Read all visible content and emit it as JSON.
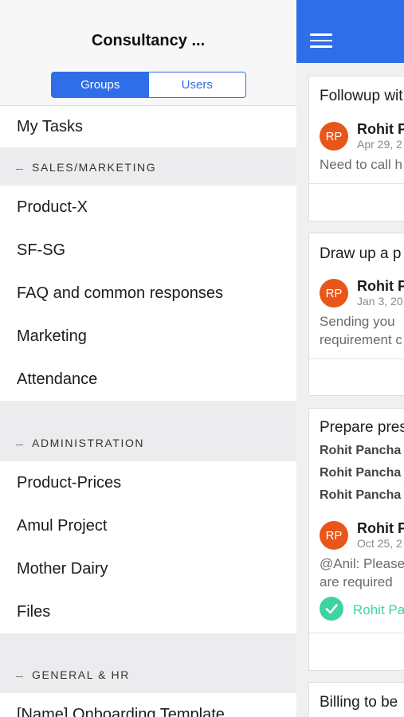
{
  "drawer": {
    "title": "Consultancy ...",
    "tabs": [
      {
        "label": "Groups",
        "active": true
      },
      {
        "label": "Users",
        "active": false
      }
    ],
    "my_tasks": "My Tasks",
    "sections": [
      {
        "title": "SALES/MARKETING",
        "items": [
          "Product-X",
          "SF-SG",
          "FAQ and common responses",
          "Marketing",
          "Attendance"
        ]
      },
      {
        "title": "ADMINISTRATION",
        "items": [
          "Product-Prices",
          "Amul Project",
          "Mother Dairy",
          "Files"
        ]
      },
      {
        "title": "GENERAL & HR",
        "items": [
          "[Name] Onboarding Template"
        ]
      }
    ]
  },
  "topbar": {
    "menu_icon": "hamburger-menu-icon",
    "color": "#2f6ee8"
  },
  "cards": [
    {
      "title": "Followup wit",
      "avatar": "RP",
      "author": "Rohit P",
      "date": "Apr 29, 2",
      "text": [
        "Need to call h"
      ]
    },
    {
      "title": "Draw up a p",
      "avatar": "RP",
      "author": "Rohit P",
      "date": "Jan 3, 20",
      "text": [
        "Sending you",
        "requirement c"
      ]
    },
    {
      "title": "Prepare pres",
      "mentions": [
        "Rohit Pancha",
        "Rohit Pancha",
        "Rohit Pancha"
      ],
      "avatar": "RP",
      "author": "Rohit P",
      "date": "Oct 25, 2",
      "text": [
        "@Anil: Please",
        "are required"
      ],
      "completed_by": "Rohit Pa"
    },
    {
      "title": "Billing to be"
    }
  ],
  "colors": {
    "accent": "#2f6ee8",
    "avatar": "#e8561a",
    "success": "#3ed3a3",
    "section_bg": "#ececef"
  }
}
